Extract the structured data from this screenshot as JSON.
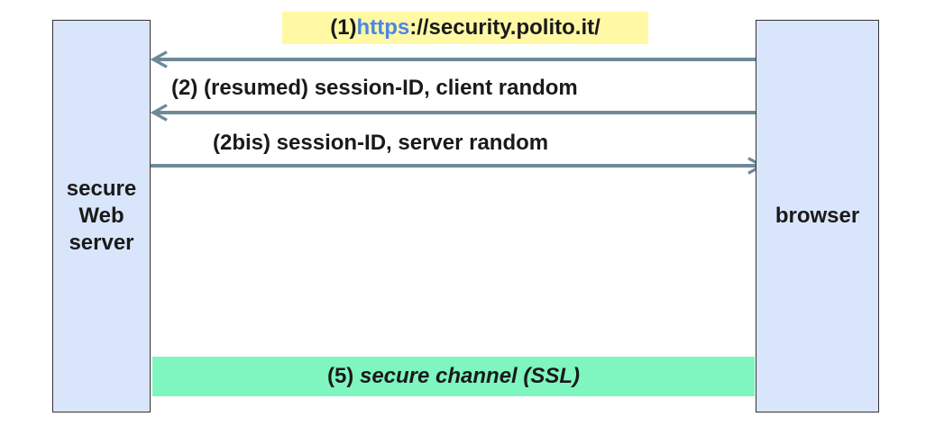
{
  "server": {
    "label": "secure\nWeb\nserver"
  },
  "browser": {
    "label": "browser"
  },
  "messages": {
    "m1": {
      "prefix": "(1) ",
      "protocol": "https",
      "rest": "://security.polito.it/"
    },
    "m2": "(2) (resumed) session-ID, client random",
    "m2bis": "(2bis) session-ID, server random"
  },
  "channel": {
    "prefix": "(5) ",
    "label": "secure channel (SSL)"
  },
  "colors": {
    "box_fill": "#d9e5fb",
    "arrow": "#6e8a98",
    "highlight_yellow": "#fff9a6",
    "protocol_blue": "#4a86e8",
    "channel_green": "#7ff5c0"
  }
}
